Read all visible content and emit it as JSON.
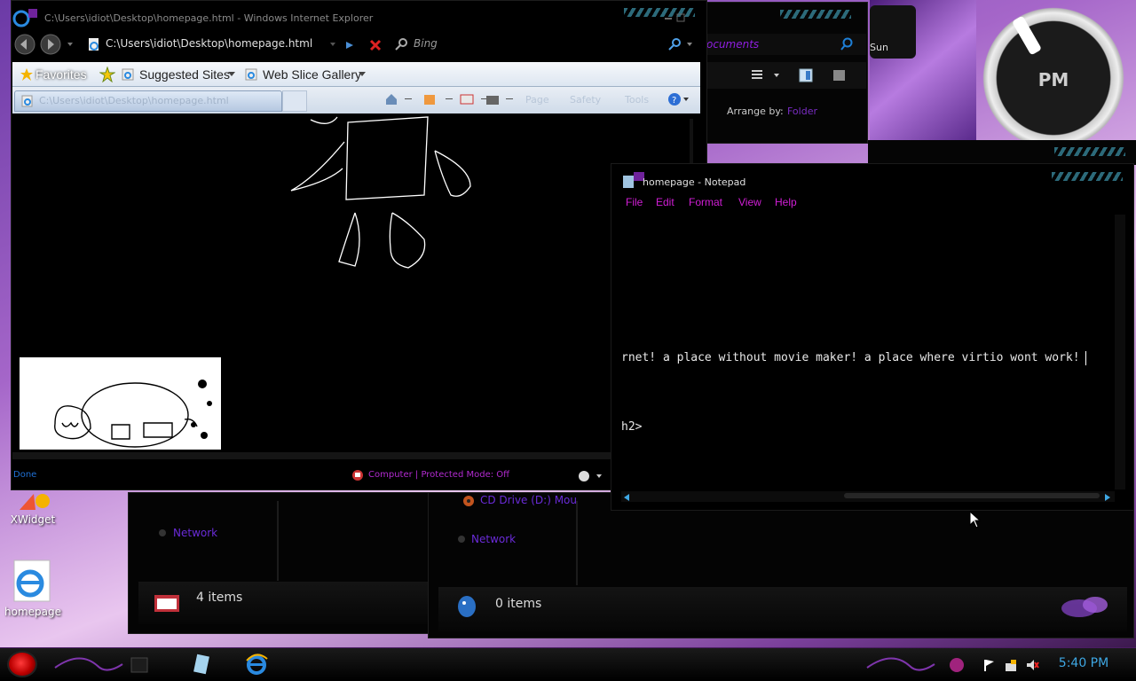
{
  "ie": {
    "title": "C:\\Users\\idiot\\Desktop\\homepage.html - Windows Internet Explorer",
    "address": "C:\\Users\\idiot\\Desktop\\homepage.html",
    "search_placeholder": "Bing",
    "favorites_label": "Favorites",
    "favorites_items": [
      "Suggested Sites",
      "Web Slice Gallery"
    ],
    "tab_title": "C:\\Users\\idiot\\Desktop\\homepage.html",
    "command_bar": [
      "Page",
      "Safety",
      "Tools"
    ],
    "status_text": "Done",
    "zone_text": "Computer | Protected Mode: Off"
  },
  "notepad": {
    "title": "homepage - Notepad",
    "menu": [
      "File",
      "Edit",
      "Format",
      "View",
      "Help"
    ],
    "lines": [
      "rnet! a place without movie maker! a place where virtio wont work!",
      "h2>"
    ]
  },
  "explorer_top": {
    "address_fragment": "ocuments",
    "arrange_label": "Arrange by:",
    "arrange_value": "Folder"
  },
  "explorer_left": {
    "nav_item": "Network",
    "status": "4 items"
  },
  "explorer_right": {
    "drive_item": "CD Drive (D:) Mou",
    "nav_item": "Network",
    "status": "0 items"
  },
  "desktop": {
    "icons": [
      {
        "label": "XWidget",
        "icon": "xwidget-icon"
      },
      {
        "label": "homepage",
        "icon": "ie-icon"
      }
    ]
  },
  "gadget": {
    "period": "PM",
    "day": "Sun"
  },
  "taskbar": {
    "clock": "5:40 PM",
    "pinned": [
      "explorer-icon",
      "notepad-icon",
      "ie-icon"
    ]
  },
  "colors": {
    "accent_blue": "#3ea7e3",
    "accent_magenta": "#d21ed7",
    "accent_purple": "#7a2cc4"
  }
}
